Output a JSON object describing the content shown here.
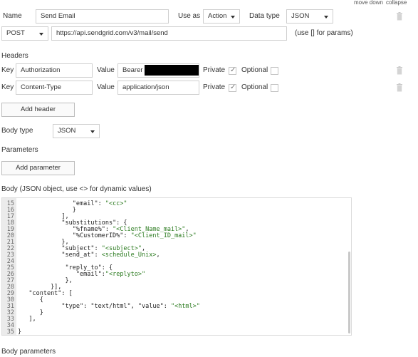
{
  "header_links": {
    "move_down": "move down",
    "collapse": "collapse"
  },
  "name": {
    "label": "Name",
    "value": "Send Email"
  },
  "use_as": {
    "label": "Use as",
    "value": "Action"
  },
  "data_type": {
    "label": "Data type",
    "value": "JSON"
  },
  "method": {
    "value": "POST"
  },
  "url": {
    "value": "https://api.sendgrid.com/v3/mail/send",
    "hint": "(use [] for params)"
  },
  "headers": {
    "title": "Headers",
    "key_label": "Key",
    "value_label": "Value",
    "private_label": "Private",
    "optional_label": "Optional",
    "rows": [
      {
        "key": "Authorization",
        "value": "Bearer",
        "private": true,
        "optional": false
      },
      {
        "key": "Content-Type",
        "value": "application/json",
        "private": true,
        "optional": false
      }
    ],
    "add_button": "Add header"
  },
  "body_type": {
    "label": "Body type",
    "value": "JSON"
  },
  "parameters": {
    "title": "Parameters",
    "add_button": "Add parameter"
  },
  "body": {
    "label": "Body (JSON object, use <> for dynamic values)",
    "lines": [
      {
        "n": "15",
        "indent": "               ",
        "parts": [
          [
            "\"email\": ",
            ""
          ],
          [
            "\"<cc>\"",
            "str"
          ]
        ]
      },
      {
        "n": "16",
        "indent": "               ",
        "parts": [
          [
            "}",
            ""
          ]
        ]
      },
      {
        "n": "17",
        "indent": "            ",
        "parts": [
          [
            "],",
            ""
          ]
        ]
      },
      {
        "n": "18",
        "indent": "            ",
        "parts": [
          [
            "\"substitutions\": {",
            ""
          ]
        ]
      },
      {
        "n": "19",
        "indent": "               ",
        "parts": [
          [
            "\"%fname%\": ",
            ""
          ],
          [
            "\"<Client_Name_mail>\"",
            "str"
          ],
          [
            ",",
            ""
          ]
        ]
      },
      {
        "n": "20",
        "indent": "               ",
        "parts": [
          [
            "\"%CustomerID%\": ",
            ""
          ],
          [
            "\"<Client_ID_mail>\"",
            "str"
          ]
        ]
      },
      {
        "n": "21",
        "indent": "            ",
        "parts": [
          [
            "},",
            ""
          ]
        ]
      },
      {
        "n": "22",
        "indent": "            ",
        "parts": [
          [
            "\"subject\": ",
            ""
          ],
          [
            "\"<subject>\"",
            "str"
          ],
          [
            ",",
            ""
          ]
        ]
      },
      {
        "n": "23",
        "indent": "            ",
        "parts": [
          [
            "\"send_at\": ",
            ""
          ],
          [
            "<schedule_Unix>",
            "str"
          ],
          [
            ",",
            ""
          ]
        ]
      },
      {
        "n": "24",
        "indent": "",
        "parts": [
          [
            "",
            ""
          ]
        ]
      },
      {
        "n": "25",
        "indent": "             ",
        "parts": [
          [
            "\"reply_to\": {",
            ""
          ]
        ]
      },
      {
        "n": "26",
        "indent": "                ",
        "parts": [
          [
            "\"email\":",
            ""
          ],
          [
            "\"<replyto>\"",
            "str"
          ]
        ]
      },
      {
        "n": "27",
        "indent": "             ",
        "parts": [
          [
            "},",
            ""
          ]
        ]
      },
      {
        "n": "28",
        "indent": "         ",
        "parts": [
          [
            "}],",
            ""
          ]
        ]
      },
      {
        "n": "29",
        "indent": "   ",
        "parts": [
          [
            "\"content\": [",
            ""
          ]
        ]
      },
      {
        "n": "30",
        "indent": "      ",
        "parts": [
          [
            "{",
            ""
          ]
        ]
      },
      {
        "n": "31",
        "indent": "            ",
        "parts": [
          [
            "\"type\": \"text/html\", \"value\": ",
            ""
          ],
          [
            "\"<html>\"",
            "str"
          ]
        ]
      },
      {
        "n": "32",
        "indent": "      ",
        "parts": [
          [
            "}",
            ""
          ]
        ]
      },
      {
        "n": "33",
        "indent": "   ",
        "parts": [
          [
            "],",
            ""
          ]
        ]
      },
      {
        "n": "34",
        "indent": "",
        "parts": [
          [
            "",
            ""
          ]
        ]
      },
      {
        "n": "35",
        "indent": "",
        "parts": [
          [
            "}",
            ""
          ]
        ]
      }
    ]
  },
  "body_parameters": {
    "title": "Body parameters"
  }
}
